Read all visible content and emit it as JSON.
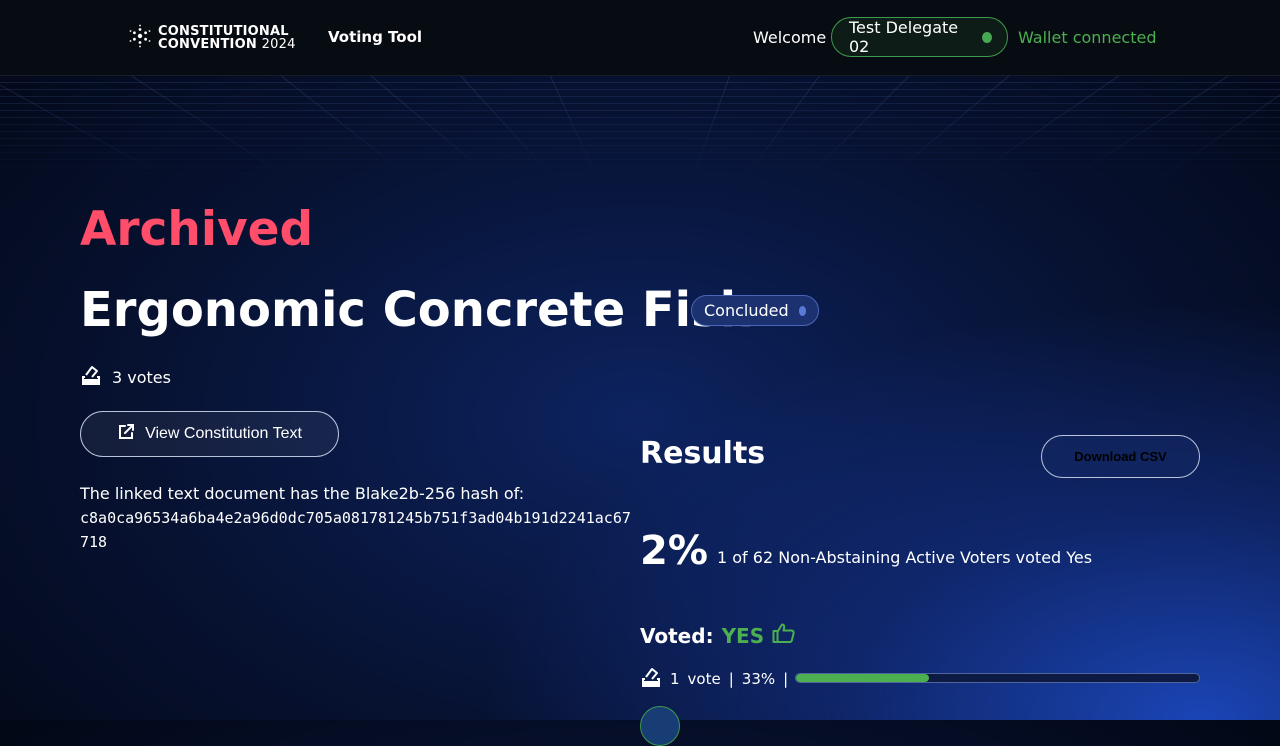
{
  "header": {
    "logo_line1": "CONSTITUTIONAL",
    "logo_line2_a": "CONVENTION",
    "logo_line2_b": "2024",
    "nav_link": "Voting Tool",
    "welcome": "Welcome",
    "delegate_name": "Test Delegate 02",
    "wallet_status": "Wallet connected"
  },
  "proposal": {
    "status_heading": "Archived",
    "title": "Ergonomic Concrete Fish",
    "badge": "Concluded",
    "votes_count": "3 votes",
    "view_button": "View Constitution Text",
    "hash_intro": "The linked text document has the Blake2b-256 hash of:",
    "hash_value": "c8a0ca96534a6ba4e2a96d0dc705a081781245b751f3ad04b191d2241ac67718"
  },
  "results": {
    "title": "Results",
    "download_button": "Download CSV",
    "percentage": "2%",
    "description": "1 of 62 Non-Abstaining Active Voters voted Yes",
    "voted_label": "Voted:",
    "voted_value": "YES",
    "vote_count": "1",
    "vote_word": "vote",
    "separator": "|",
    "vote_percent": "33%",
    "progress_fraction": 0.33
  },
  "colors": {
    "archived": "#ff4d6a",
    "green": "#4caf50",
    "badge_bg": "#1b3170"
  },
  "icons": [
    "cardano-logo-icon",
    "ballot-box-icon",
    "external-link-icon",
    "thumbs-up-icon"
  ]
}
